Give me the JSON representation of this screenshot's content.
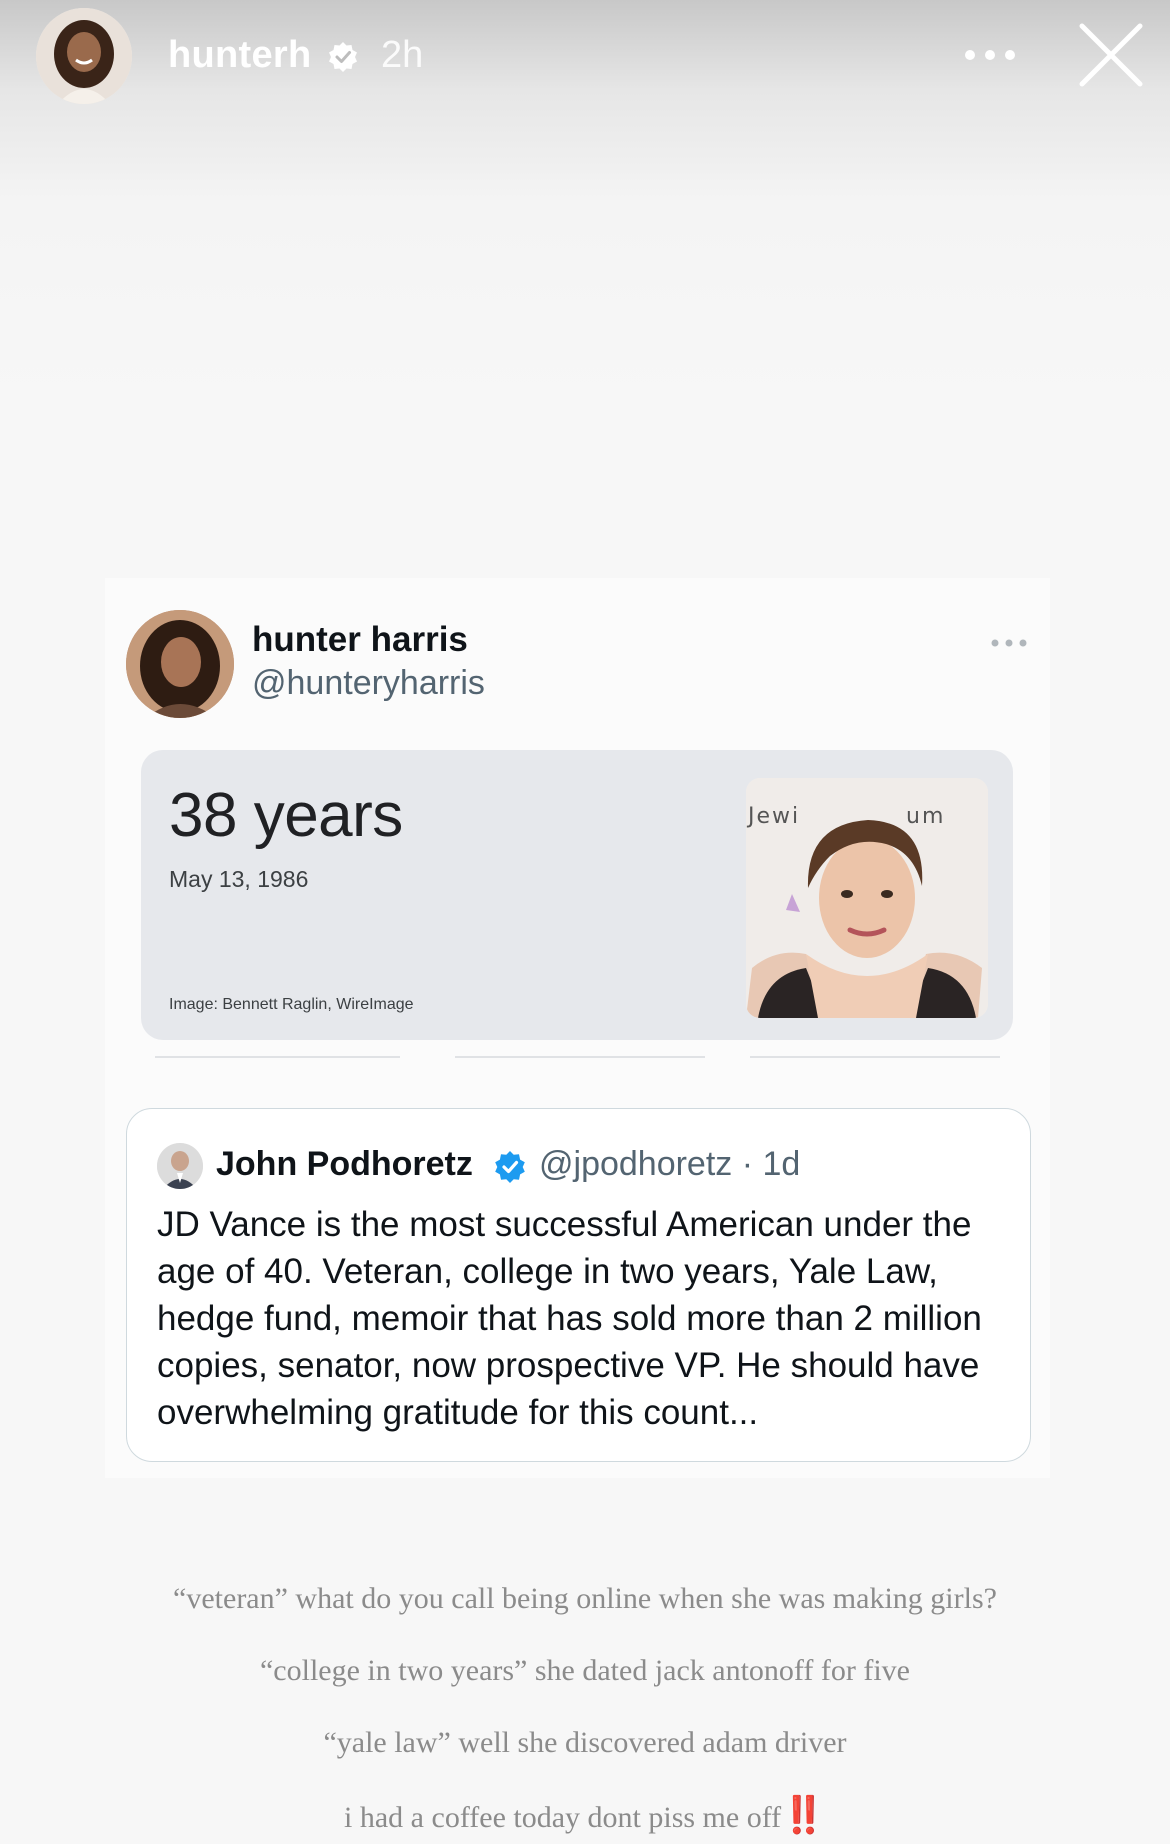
{
  "story": {
    "username": "hunterh",
    "time": "2h"
  },
  "tweet": {
    "name": "hunter harris",
    "handle": "@hunteryharris",
    "age_card": {
      "title": "38 years",
      "date": "May 13, 1986",
      "credit": "Image: Bennett Raglin, WireImage",
      "photo_text_left": "Jewi",
      "photo_text_right": "um"
    },
    "quote": {
      "name": "John Podhoretz",
      "meta": "@jpodhoretz · 1d",
      "body": "JD Vance is the most successful American under the age of 40. Veteran, college in two years, Yale Law, hedge fund, memoir that has sold more than 2 million copies, senator, now prospective VP. He should have overwhelming gratitude for this count..."
    }
  },
  "captions": {
    "line1": "“veteran” what do you call being online when she was making girls?",
    "line2": "“college in two years” she dated jack antonoff for five",
    "line3": "“yale law” well she discovered adam driver",
    "line4": "i had a coffee today dont piss me off",
    "line4_emoji": "‼️"
  },
  "colors": {
    "verified_blue": "#1d9bf0",
    "caption_gray": "#8b8b8b",
    "emoji_red": "#e0202a"
  }
}
